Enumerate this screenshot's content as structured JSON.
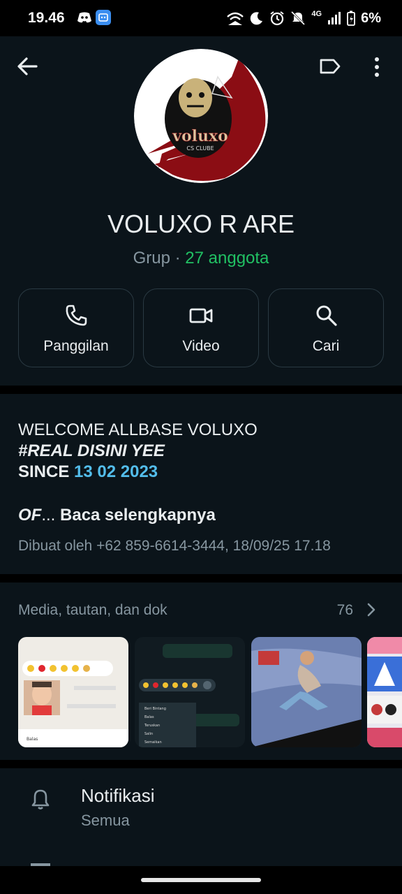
{
  "status_bar": {
    "time": "19.46",
    "network": "4G",
    "battery": "6%"
  },
  "group": {
    "name": "VOLUXO R ARE",
    "type_label": "Grup",
    "separator": " · ",
    "member_count": "27 anggota",
    "avatar_title": "voluxo",
    "avatar_subtitle": "CS CLUBE"
  },
  "actions": [
    {
      "label": "Panggilan",
      "icon": "phone-icon"
    },
    {
      "label": "Video",
      "icon": "video-icon"
    },
    {
      "label": "Cari",
      "icon": "search-icon"
    }
  ],
  "description": {
    "line1": "WELCOME ALLBASE VOLUXO",
    "line2": "#REAL DISINI YEE",
    "line3_prefix": "SINCE ",
    "line3_date": "13 02 2023",
    "line4_prefix": "OF",
    "line4_ellipsis": "...",
    "read_more": "Baca selengkapnya",
    "created_by": "Dibuat oleh +62 859-6614-3444, 18/09/25 17.18"
  },
  "media": {
    "title": "Media, tautan, dan dok",
    "count": "76",
    "thumb1_menu_item": "Balas",
    "thumb2_menu_items": [
      "Beri Bintang",
      "Balas",
      "Teruskan",
      "Salin",
      "Semaikan"
    ]
  },
  "notifications": {
    "title": "Notifikasi",
    "value": "Semua"
  },
  "colors": {
    "accent_green": "#21c063",
    "link_blue": "#53bdeb",
    "background": "#0b141a"
  }
}
